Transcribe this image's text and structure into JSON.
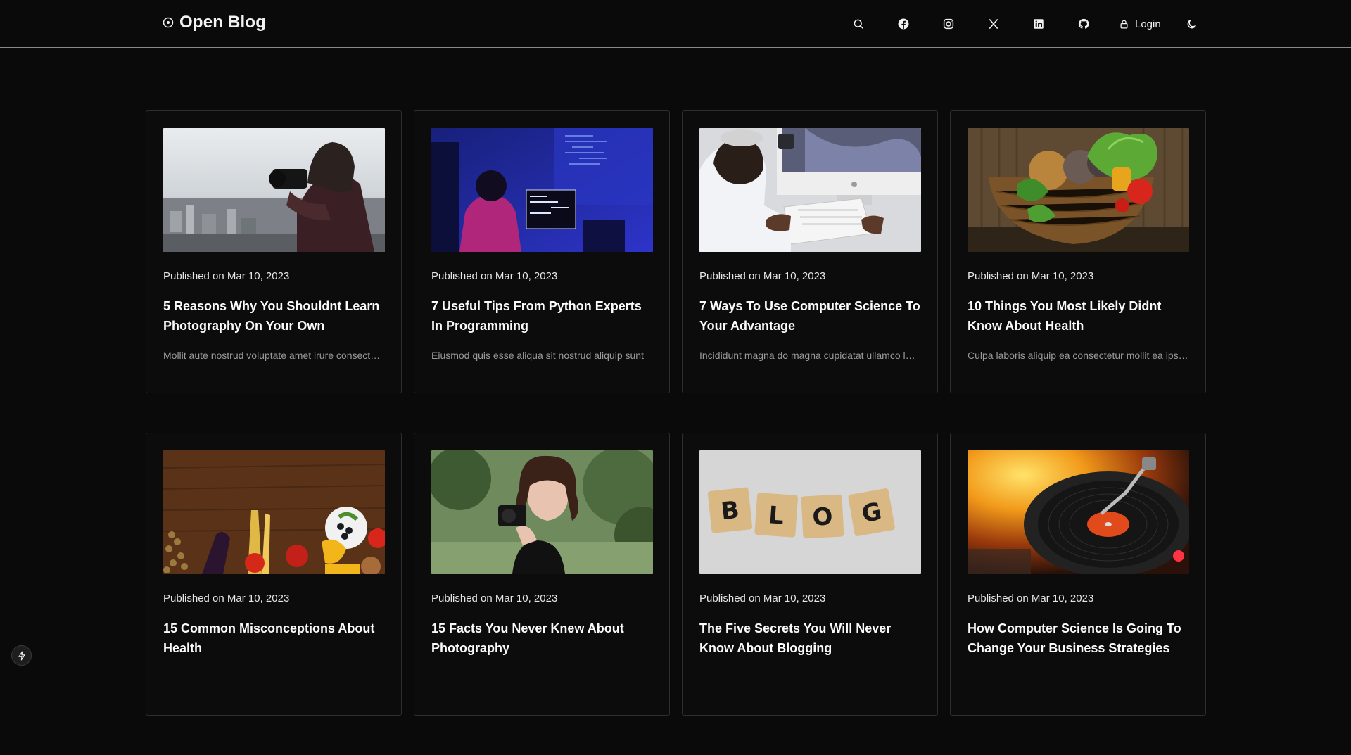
{
  "header": {
    "brand": "Open Blog",
    "brand_icon": "circle-dot-icon",
    "nav_icons": [
      "search-icon",
      "facebook-icon",
      "instagram-icon",
      "x-twitter-icon",
      "linkedin-icon",
      "github-icon"
    ],
    "login_label": "Login",
    "theme_icon": "moon-icon"
  },
  "posts": [
    {
      "date": "Published on Mar 10, 2023",
      "title": "5 Reasons Why You Shouldnt Learn Photography On Your Own",
      "excerpt": "Mollit aute nostrud voluptate amet irure consectetur"
    },
    {
      "date": "Published on Mar 10, 2023",
      "title": "7 Useful Tips From Python Experts In Programming",
      "excerpt": "Eiusmod quis esse aliqua sit nostrud aliquip sunt"
    },
    {
      "date": "Published on Mar 10, 2023",
      "title": "7 Ways To Use Computer Science To Your Advantage",
      "excerpt": "Incididunt magna do magna cupidatat ullamco labore"
    },
    {
      "date": "Published on Mar 10, 2023",
      "title": "10 Things You Most Likely Didnt Know About Health",
      "excerpt": "Culpa laboris aliquip ea consectetur mollit ea ipsum"
    },
    {
      "date": "Published on Mar 10, 2023",
      "title": "15 Common Misconceptions About Health",
      "excerpt": ""
    },
    {
      "date": "Published on Mar 10, 2023",
      "title": "15 Facts You Never Knew About Photography",
      "excerpt": ""
    },
    {
      "date": "Published on Mar 10, 2023",
      "title": "The Five Secrets You Will Never Know About Blogging",
      "excerpt": ""
    },
    {
      "date": "Published on Mar 10, 2023",
      "title": "How Computer Science Is Going To Change Your Business Strategies",
      "excerpt": ""
    }
  ],
  "colors": {
    "background": "#0a0a0a",
    "card_border": "#2e2e2e",
    "text": "#f2f2f2",
    "muted": "#9a9a9a"
  },
  "fab_icon": "lightning-icon"
}
